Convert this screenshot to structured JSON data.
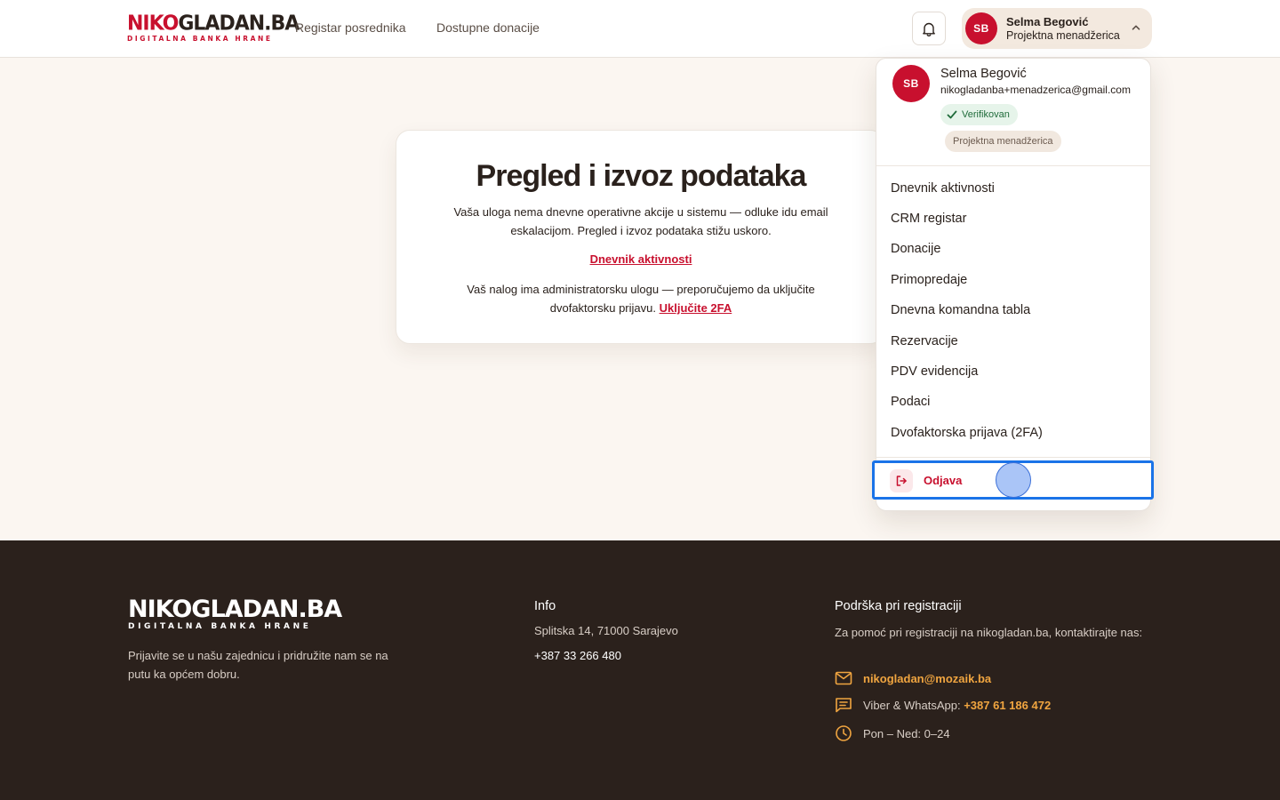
{
  "header": {
    "logo_main_red": "NIKO",
    "logo_main_dark": "GLADAN.BA",
    "logo_sub": "DIGITALNA BANKA HRANE",
    "nav": [
      "Registar posrednika",
      "Dostupne donacije"
    ],
    "user": {
      "initials": "SB",
      "name": "Selma Begović",
      "role": "Projektna menadžerica"
    }
  },
  "card": {
    "title": "Pregled i izvoz podataka",
    "text": "Vaša uloga nema dnevne operativne akcije u sistemu — odluke idu email eskalacijom. Pregled i izvoz podataka stižu uskoro.",
    "activity_link": "Dnevnik aktivnosti",
    "twofa_text": "Vaš nalog ima administratorsku ulogu — preporučujemo da uključite dvofaktorsku prijavu.",
    "twofa_link": "Uključite 2FA"
  },
  "dropdown": {
    "initials": "SB",
    "name": "Selma Begović",
    "email": "nikogladanba+menadzerica@gmail.com",
    "verified_badge": "Verifikovan",
    "role_badge": "Projektna menadžerica",
    "items": [
      "Dnevnik aktivnosti",
      "CRM registar",
      "Donacije",
      "Primopredaje",
      "Dnevna komandna tabla",
      "Rezervacije",
      "PDV evidencija",
      "Podaci",
      "Dvofaktorska prijava (2FA)"
    ],
    "logout": "Odjava"
  },
  "footer": {
    "logo_main": "NIKOGLADAN.BA",
    "logo_sub": "DIGITALNA BANKA HRANE",
    "description": "Prijavite se u našu zajednicu i pridružite nam se na putu ka općem dobru.",
    "info_heading": "Info",
    "address": "Splitska 14, 71000 Sarajevo",
    "phone": "+387 33 266 480",
    "support_heading": "Podrška pri registraciji",
    "support_text": "Za pomoć pri registraciji na nikogladan.ba, kontaktirajte nas:",
    "email": "nikogladan@mozaik.ba",
    "viber_label": "Viber & WhatsApp:",
    "viber_number": "+387 61 186 472",
    "hours": "Pon – Ned: 0–24"
  },
  "colors": {
    "brand_red": "#c8102e",
    "footer_bg": "#2b211c",
    "accent_orange": "#f0a540",
    "page_bg": "#fbf6f1",
    "focus_blue": "#1a73e8"
  },
  "icons": [
    "bell-icon",
    "chevron-up-icon",
    "check-icon",
    "logout-icon",
    "mail-icon",
    "chat-icon",
    "clock-icon"
  ]
}
